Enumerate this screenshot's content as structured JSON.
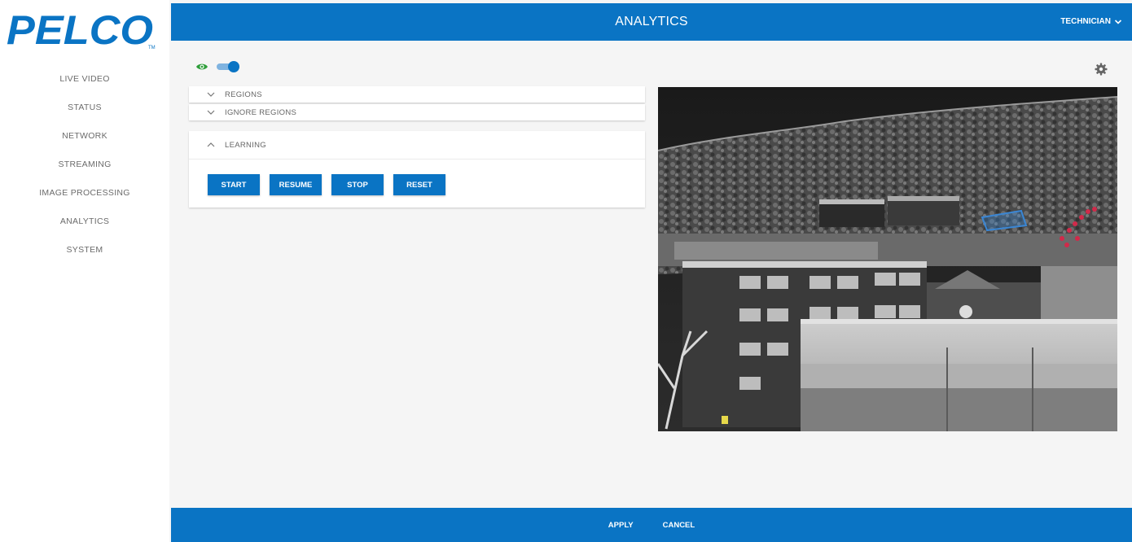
{
  "brand": {
    "logo_text": "PELCO",
    "color": "#0a74c4"
  },
  "sidebar": {
    "items": [
      {
        "label": "LIVE VIDEO"
      },
      {
        "label": "STATUS"
      },
      {
        "label": "NETWORK"
      },
      {
        "label": "STREAMING"
      },
      {
        "label": "IMAGE PROCESSING"
      },
      {
        "label": "ANALYTICS"
      },
      {
        "label": "SYSTEM"
      }
    ]
  },
  "header": {
    "title": "ANALYTICS",
    "user": "TECHNICIAN"
  },
  "toolbar": {
    "visibility_icon": "eye-icon",
    "overlay_toggle": "on",
    "settings_icon": "gear-icon"
  },
  "sections": {
    "regions": {
      "label": "REGIONS",
      "expanded": false
    },
    "ignore_regions": {
      "label": "IGNORE REGIONS",
      "expanded": false
    },
    "learning": {
      "label": "LEARNING",
      "expanded": true,
      "buttons": {
        "start": "START",
        "resume": "RESUME",
        "stop": "STOP",
        "reset": "RESET"
      }
    }
  },
  "footer": {
    "apply": "APPLY",
    "cancel": "CANCEL"
  },
  "colors": {
    "accent": "#0a74c4",
    "eye": "#2e9e3a",
    "background": "#f5f5f5"
  }
}
